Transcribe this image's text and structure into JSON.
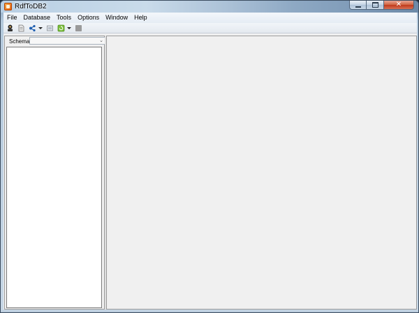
{
  "window": {
    "title": "RdfToDB2"
  },
  "menu": {
    "items": [
      "File",
      "Database",
      "Tools",
      "Options",
      "Window",
      "Help"
    ]
  },
  "toolbar": {
    "icons": [
      "connect-icon",
      "document-icon",
      "share-icon",
      "export-icon",
      "refresh-icon",
      "stop-icon"
    ]
  },
  "schema": {
    "label": "Schema",
    "selected": ""
  },
  "colors": {
    "accent": "#e2570e",
    "close": "#c0391b",
    "workspace": "#f0f0f0"
  }
}
